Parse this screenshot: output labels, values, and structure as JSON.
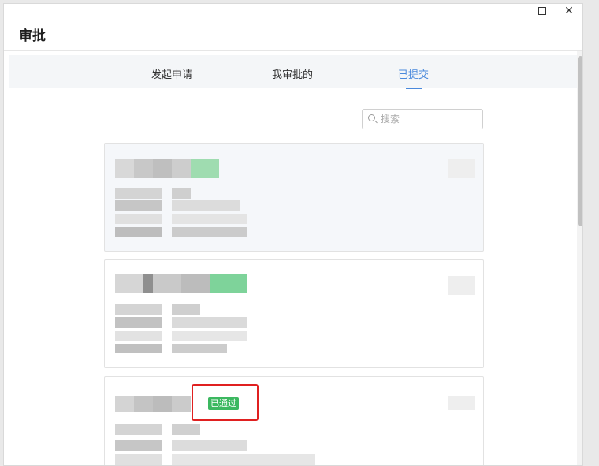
{
  "window": {
    "title": "审批"
  },
  "tabs": [
    {
      "label": "发起申请",
      "active": false
    },
    {
      "label": "我审批的",
      "active": false
    },
    {
      "label": "已提交",
      "active": true
    }
  ],
  "search": {
    "placeholder": "搜索"
  },
  "cards": [
    {
      "status": ""
    },
    {
      "status": ""
    },
    {
      "status": "已通过"
    }
  ],
  "colors": {
    "accent": "#4a89dc",
    "approved": "#3cb860",
    "highlight": "#e02020"
  },
  "icons": {
    "minimize": "minimize-icon",
    "maximize": "maximize-icon",
    "close": "close-icon",
    "search": "search-icon"
  }
}
